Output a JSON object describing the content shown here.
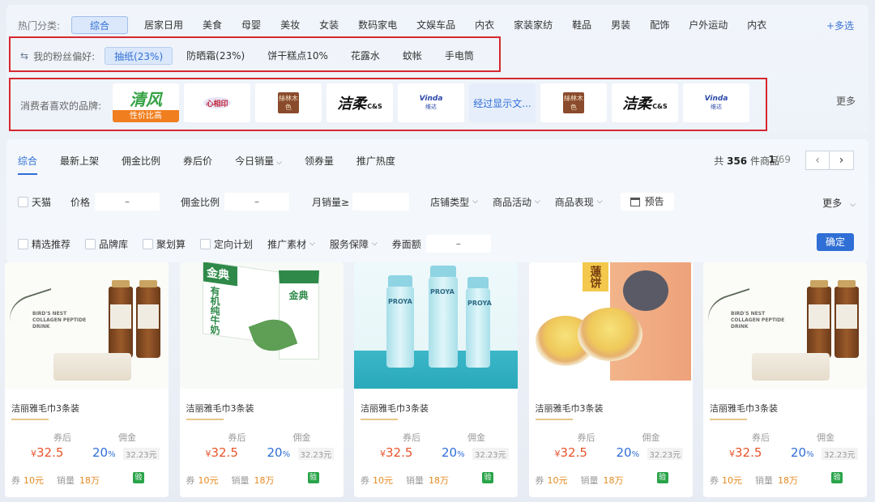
{
  "hot_categories": {
    "label": "热门分类:",
    "items": [
      "综合",
      "居家日用",
      "美食",
      "母婴",
      "美妆",
      "女装",
      "数码家电",
      "文娱车品",
      "内衣",
      "家装家纺",
      "鞋品",
      "男装",
      "配饰",
      "户外运动",
      "内衣"
    ],
    "active_index": 0,
    "more": "+多选"
  },
  "fan_prefs": {
    "icon": "swap-icon",
    "label": "我的粉丝偏好:",
    "tags": [
      "抽纸(23%)",
      "防晒霜(23%)",
      "饼干糕点10%",
      "花露水",
      "蚊帐",
      "手电筒"
    ],
    "active_index": 0
  },
  "brands": {
    "label": "消费者喜欢的品牌:",
    "items": [
      {
        "type": "logo",
        "logo": "清风",
        "badge": "性价比高"
      },
      {
        "type": "logo",
        "logo": "心相印"
      },
      {
        "type": "logo",
        "logo": "絲林木色"
      },
      {
        "type": "logo",
        "logo": "洁柔",
        "sub": "C&S"
      },
      {
        "type": "logo",
        "logo": "Vinda",
        "sub": "维达"
      },
      {
        "type": "text",
        "text": "经过显示文..."
      },
      {
        "type": "logo",
        "logo": "絲林木色"
      },
      {
        "type": "logo",
        "logo": "洁柔",
        "sub": "C&S"
      },
      {
        "type": "logo",
        "logo": "Vinda",
        "sub": "维达"
      }
    ],
    "more": "更多"
  },
  "sort_tabs": {
    "items": [
      "综合",
      "最新上架",
      "佣金比例",
      "券后价",
      "今日销量",
      "领券量",
      "推广热度"
    ],
    "active_index": 0,
    "dropdown_index": 4
  },
  "stats": {
    "prefix": "共",
    "count": "356",
    "suffix": "件商品"
  },
  "pagination": {
    "current": "1",
    "total": "/69"
  },
  "filters_row1": {
    "tmall": "天猫",
    "price": "价格",
    "price_sep": "–",
    "commission": "佣金比例",
    "commission_sep": "–",
    "monthly_sales": "月销量≥",
    "shop_type": "店铺类型",
    "activity": "商品活动",
    "performance": "商品表现",
    "preview": "预告",
    "more": "更多"
  },
  "filters_row2": {
    "featured": "精选推荐",
    "brand_lib": "品牌库",
    "juhuasuan": "聚划算",
    "targeted": "定向计划",
    "materials": "推广素材",
    "service": "服务保障",
    "coupon_amount": "券面额",
    "coupon_sep": "–",
    "confirm": "确定"
  },
  "products": [
    {
      "title": "洁丽雅毛巾3条装",
      "after_label": "券后",
      "comm_label": "佣金",
      "price_symbol": "¥",
      "price": "32.5",
      "pct": "20",
      "pct_unit": "%",
      "comm": "32.23元",
      "coupon_label": "券",
      "coupon": "10元",
      "sales_label": "销量",
      "sales": "18万",
      "verify": "验",
      "image": "birds-nest-drink"
    },
    {
      "title": "洁丽雅毛巾3条装",
      "after_label": "券后",
      "comm_label": "佣金",
      "price_symbol": "¥",
      "price": "32.5",
      "pct": "20",
      "pct_unit": "%",
      "comm": "32.23元",
      "coupon_label": "券",
      "coupon": "10元",
      "sales_label": "销量",
      "sales": "18万",
      "verify": "验",
      "image": "organic-milk"
    },
    {
      "title": "洁丽雅毛巾3条装",
      "after_label": "券后",
      "comm_label": "佣金",
      "price_symbol": "¥",
      "price": "32.5",
      "pct": "20",
      "pct_unit": "%",
      "comm": "32.23元",
      "coupon_label": "券",
      "coupon": "10元",
      "sales_label": "销量",
      "sales": "18万",
      "verify": "验",
      "image": "proya-skincare"
    },
    {
      "title": "洁丽雅毛巾3条装",
      "after_label": "券后",
      "comm_label": "佣金",
      "price_symbol": "¥",
      "price": "32.5",
      "pct": "20",
      "pct_unit": "%",
      "comm": "32.23元",
      "coupon_label": "券",
      "coupon": "10元",
      "sales_label": "销量",
      "sales": "18万",
      "verify": "验",
      "image": "lotus-cake"
    },
    {
      "title": "洁丽雅毛巾3条装",
      "after_label": "券后",
      "comm_label": "佣金",
      "price_symbol": "¥",
      "price": "32.5",
      "pct": "20",
      "pct_unit": "%",
      "comm": "32.23元",
      "coupon_label": "券",
      "coupon": "10元",
      "sales_label": "销量",
      "sales": "18万",
      "verify": "验",
      "image": "birds-nest-drink"
    }
  ],
  "product_image_text": {
    "birds_nest": "BIRD'S NEST\nCOLLAGEN PEPTIDE DRINK",
    "milk_brand": "金典",
    "milk_sub": "有机纯牛奶",
    "proya": "PROYA",
    "cake": "蓮饼"
  },
  "colors": {
    "accent": "#2f6fd6",
    "highlight_border": "#d5282f",
    "price": "#e8542b",
    "badge": "#f07e1e",
    "verify": "#2aa44a"
  }
}
